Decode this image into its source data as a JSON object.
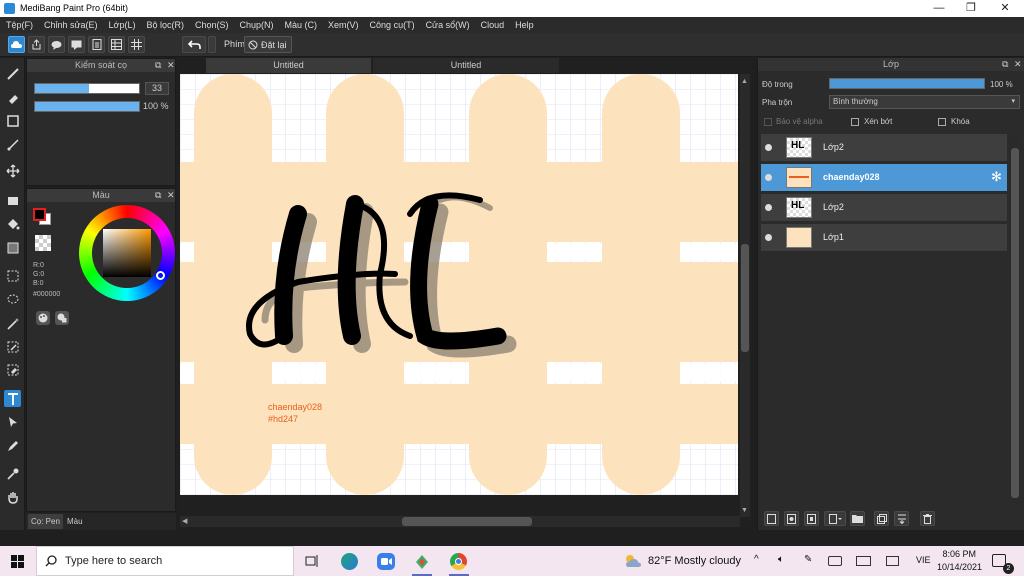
{
  "window": {
    "title": "MediBang Paint Pro (64bit)",
    "minimize": "—",
    "maximize": "❐",
    "close": "✕"
  },
  "menu": [
    "Tệp(F)",
    "Chỉnh sửa(E)",
    "Lớp(L)",
    "Bộ lọc(R)",
    "Chọn(S)",
    "Chụp(N)",
    "Màu (C)",
    "Xem(V)",
    "Công cụ(T)",
    "Cửa sổ(W)",
    "Cloud",
    "Help"
  ],
  "toolbar": {
    "key_label": "Phím",
    "reset_label": "Đặt lại"
  },
  "brush_panel": {
    "title": "Kiểm soát cọ",
    "size_value": "33",
    "size_fraction": 0.52,
    "opacity_value": "100 %",
    "opacity_fraction": 1.0
  },
  "color_panel": {
    "title": "Màu",
    "r": "R:0",
    "g": "G:0",
    "b": "B:0",
    "hex": "#000000"
  },
  "left_tabs": [
    "Cọ: Pen",
    "Màu"
  ],
  "canvas": {
    "tabs": [
      "Untitled",
      "Untitled"
    ],
    "watermark_line1": "chaenday028",
    "watermark_line2": "#hd247",
    "artwork_text": "HL"
  },
  "layer_panel": {
    "title": "Lớp",
    "opacity_label": "Độ trong",
    "opacity_value": "100 %",
    "opacity_fraction": 1.0,
    "blend_label": "Pha trộn",
    "blend_value": "Bình thường",
    "protect_alpha": "Bảo vệ alpha",
    "clipping": "Xén bớt",
    "lock": "Khóa",
    "layers": [
      {
        "name": "Lớp2",
        "selected": false
      },
      {
        "name": "chaenday028",
        "selected": true
      },
      {
        "name": "Lớp2",
        "selected": false
      },
      {
        "name": "Lớp1",
        "selected": false
      }
    ]
  },
  "taskbar": {
    "search_placeholder": "Type here to search",
    "weather": "82°F  Mostly cloudy",
    "lang": "VIE",
    "time": "8:06 PM",
    "date": "10/14/2021",
    "notif_count": "2"
  },
  "colors": {
    "accent": "#2e88d2",
    "canvas_peach": "#fde3bd",
    "watermark": "#e8601c"
  }
}
